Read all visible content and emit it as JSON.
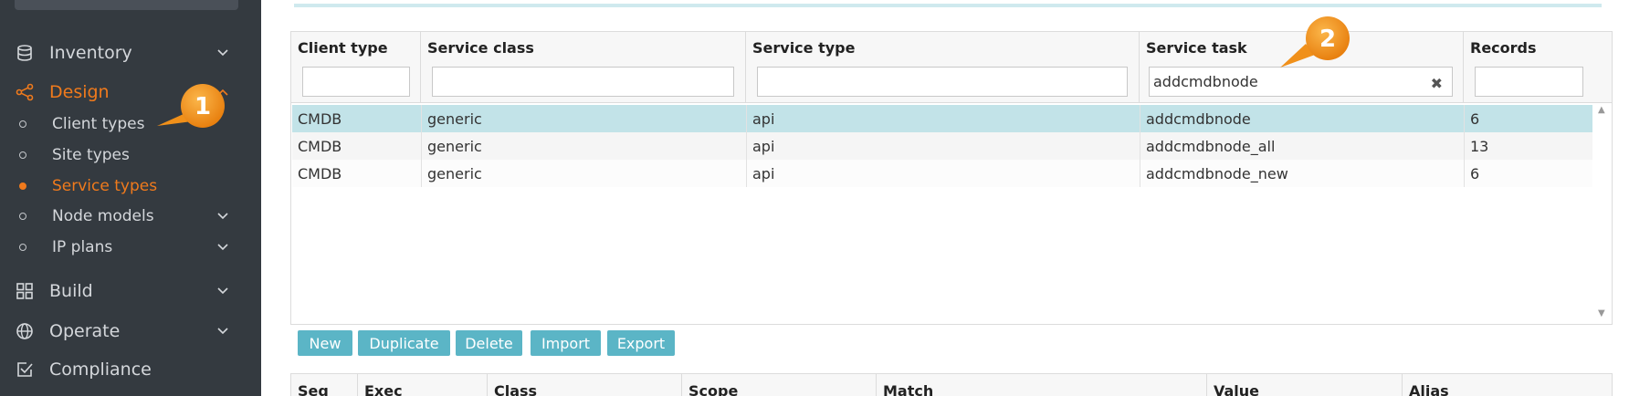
{
  "sidebar": {
    "items": [
      {
        "label": "Inventory",
        "icon": "database-icon"
      },
      {
        "label": "Design",
        "icon": "share-icon"
      },
      {
        "label": "Build",
        "icon": "grid-icon"
      },
      {
        "label": "Operate",
        "icon": "globe-icon"
      },
      {
        "label": "Compliance",
        "icon": "check-square-icon"
      }
    ],
    "design_sub": [
      {
        "label": "Client types"
      },
      {
        "label": "Site types"
      },
      {
        "label": "Service types"
      },
      {
        "label": "Node models"
      },
      {
        "label": "IP plans"
      }
    ],
    "accent": "#f07a1c"
  },
  "grid": {
    "columns": [
      "Client type",
      "Service class",
      "Service type",
      "Service task",
      "Records"
    ],
    "filters": {
      "service_task": "addcmdbnode"
    },
    "rows": [
      [
        "CMDB",
        "generic",
        "api",
        "addcmdbnode",
        "6"
      ],
      [
        "CMDB",
        "generic",
        "api",
        "addcmdbnode_all",
        "13"
      ],
      [
        "CMDB",
        "generic",
        "api",
        "addcmdbnode_new",
        "6"
      ]
    ]
  },
  "buttons": {
    "new": "New",
    "duplicate": "Duplicate",
    "delete": "Delete",
    "import": "Import",
    "export": "Export"
  },
  "grid2": {
    "columns": [
      "Seq",
      "Exec",
      "Class",
      "Scope",
      "Match",
      "Value",
      "Alias"
    ]
  },
  "callouts": {
    "one": "1",
    "two": "2",
    "color": "#f59a1c"
  }
}
